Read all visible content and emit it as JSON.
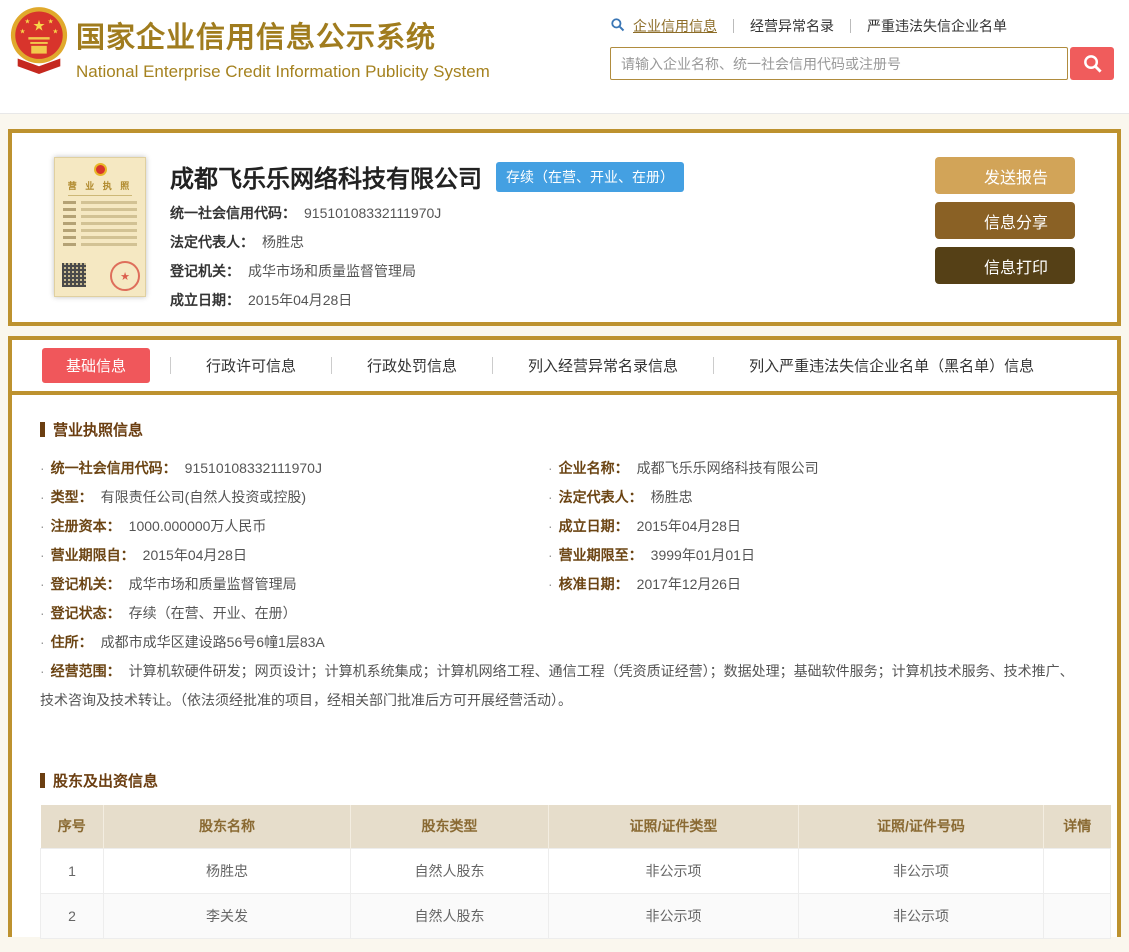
{
  "colors": {
    "gold_border": "#bd922f",
    "title_gold": "#a07c1e",
    "accent_red": "#f0575b",
    "badge_blue": "#44a0e2",
    "button_report": "#d2a458",
    "button_share": "#8a6125",
    "button_print": "#554016"
  },
  "bullet": "·",
  "header": {
    "title": "国家企业信用信息公示系统",
    "subtitle": "National Enterprise Credit Information Publicity System",
    "nav": [
      {
        "label": "企业信用信息",
        "active": true
      },
      {
        "label": "经营异常名录",
        "active": false
      },
      {
        "label": "严重违法失信企业名单",
        "active": false
      }
    ],
    "search": {
      "placeholder": "请输入企业名称、统一社会信用代码或注册号"
    }
  },
  "company_card": {
    "license_title": "营 业 执 照",
    "name": "成都飞乐乐网络科技有限公司",
    "status_badge": "存续（在营、开业、在册）",
    "fields": [
      {
        "label": "统一社会信用代码：",
        "value": "91510108332111970J"
      },
      {
        "label": "法定代表人：",
        "value": "杨胜忠"
      },
      {
        "label": "登记机关：",
        "value": "成华市场和质量监督管理局"
      },
      {
        "label": "成立日期：",
        "value": "2015年04月28日"
      }
    ],
    "buttons": {
      "report": "发送报告",
      "share": "信息分享",
      "print": "信息打印"
    }
  },
  "tabs": [
    "基础信息",
    "行政许可信息",
    "行政处罚信息",
    "列入经营异常名录信息",
    "列入严重违法失信企业名单（黑名单）信息"
  ],
  "license_section": {
    "title": "营业执照信息",
    "left_fields": [
      {
        "label": "统一社会信用代码：",
        "value": "91510108332111970J"
      },
      {
        "label": "类型：",
        "value": "有限责任公司(自然人投资或控股)"
      },
      {
        "label": "注册资本：",
        "value": "1000.000000万人民币"
      },
      {
        "label": "营业期限自：",
        "value": "2015年04月28日"
      },
      {
        "label": "登记机关：",
        "value": "成华市场和质量监督管理局"
      },
      {
        "label": "登记状态：",
        "value": "存续（在营、开业、在册）"
      },
      {
        "label": "住所：",
        "value": "成都市成华区建设路56号6幢1层83A"
      }
    ],
    "right_fields": [
      {
        "label": "企业名称：",
        "value": "成都飞乐乐网络科技有限公司"
      },
      {
        "label": "法定代表人：",
        "value": "杨胜忠"
      },
      {
        "label": "成立日期：",
        "value": "2015年04月28日"
      },
      {
        "label": "营业期限至：",
        "value": "3999年01月01日"
      },
      {
        "label": "核准日期：",
        "value": "2017年12月26日"
      }
    ],
    "scope_label": "经营范围：",
    "scope_value": "计算机软硬件研发；网页设计；计算机系统集成；计算机网络工程、通信工程（凭资质证经营）；数据处理；基础软件服务；计算机技术服务、技术推广、 技术咨询及技术转让。（依法须经批准的项目，经相关部门批准后方可开展经营活动）。"
  },
  "shareholders_section": {
    "title": "股东及出资信息",
    "columns": [
      "序号",
      "股东名称",
      "股东类型",
      "证照/证件类型",
      "证照/证件号码",
      "详情"
    ],
    "rows": [
      [
        "1",
        "杨胜忠",
        "自然人股东",
        "非公示项",
        "非公示项",
        ""
      ],
      [
        "2",
        "李关发",
        "自然人股东",
        "非公示项",
        "非公示项",
        ""
      ]
    ]
  }
}
